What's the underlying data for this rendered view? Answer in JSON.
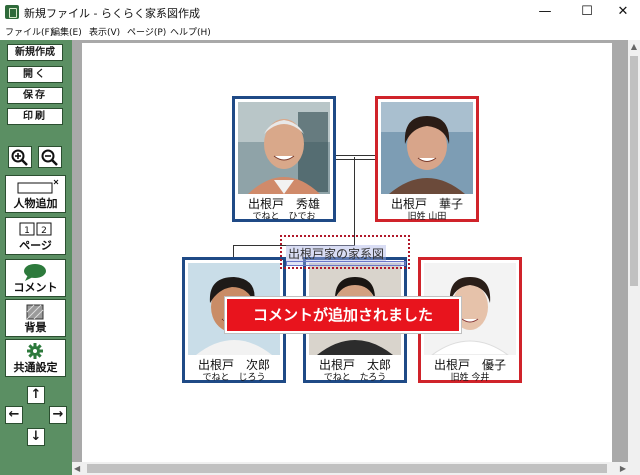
{
  "window": {
    "title": "新規ファイル - らくらく家系図作成",
    "minimize": "—",
    "maximize": "☐",
    "close": "✕"
  },
  "menu": [
    "ファイル(F)",
    "編集(E)",
    "表示(V)",
    "ページ(P)",
    "ヘルプ(H)"
  ],
  "toolbar": {
    "new": "新規作成",
    "open": "開く",
    "save": "保存",
    "print": "印刷",
    "zoom_in_icon": "zoom-in-icon",
    "zoom_out_icon": "zoom-out-icon",
    "add_person": "人物追加",
    "page": "ページ",
    "page_icon_nums": [
      "1",
      "2"
    ],
    "comment": "コメント",
    "background": "背景",
    "common_settings": "共通設定",
    "arrows": {
      "up": "↑",
      "left": "←",
      "right": "→",
      "down": "↓"
    }
  },
  "tree": {
    "family_title": "出根戸家の家系図",
    "people": [
      {
        "id": "hideo",
        "name": "出根戸　秀雄",
        "kana": "でねと　ひでお",
        "border": "#1f4a86"
      },
      {
        "id": "hanako",
        "name": "出根戸　華子",
        "kana": "旧姓 山田",
        "border": "#d0232a"
      },
      {
        "id": "jiro",
        "name": "出根戸　次郎",
        "kana": "でねと　じろう",
        "border": "#1f4a86"
      },
      {
        "id": "taro",
        "name": "出根戸　太郎",
        "kana": "でねと　たろう",
        "border": "#1f4a86"
      },
      {
        "id": "yuko",
        "name": "出根戸　優子",
        "kana": "旧姓 今井",
        "border": "#d0232a"
      }
    ]
  },
  "notification": "コメントが追加されました",
  "colors": {
    "sidebar": "#5b8f63",
    "male_border": "#1f4a86",
    "female_border": "#d0232a",
    "toast": "#e8141d"
  }
}
